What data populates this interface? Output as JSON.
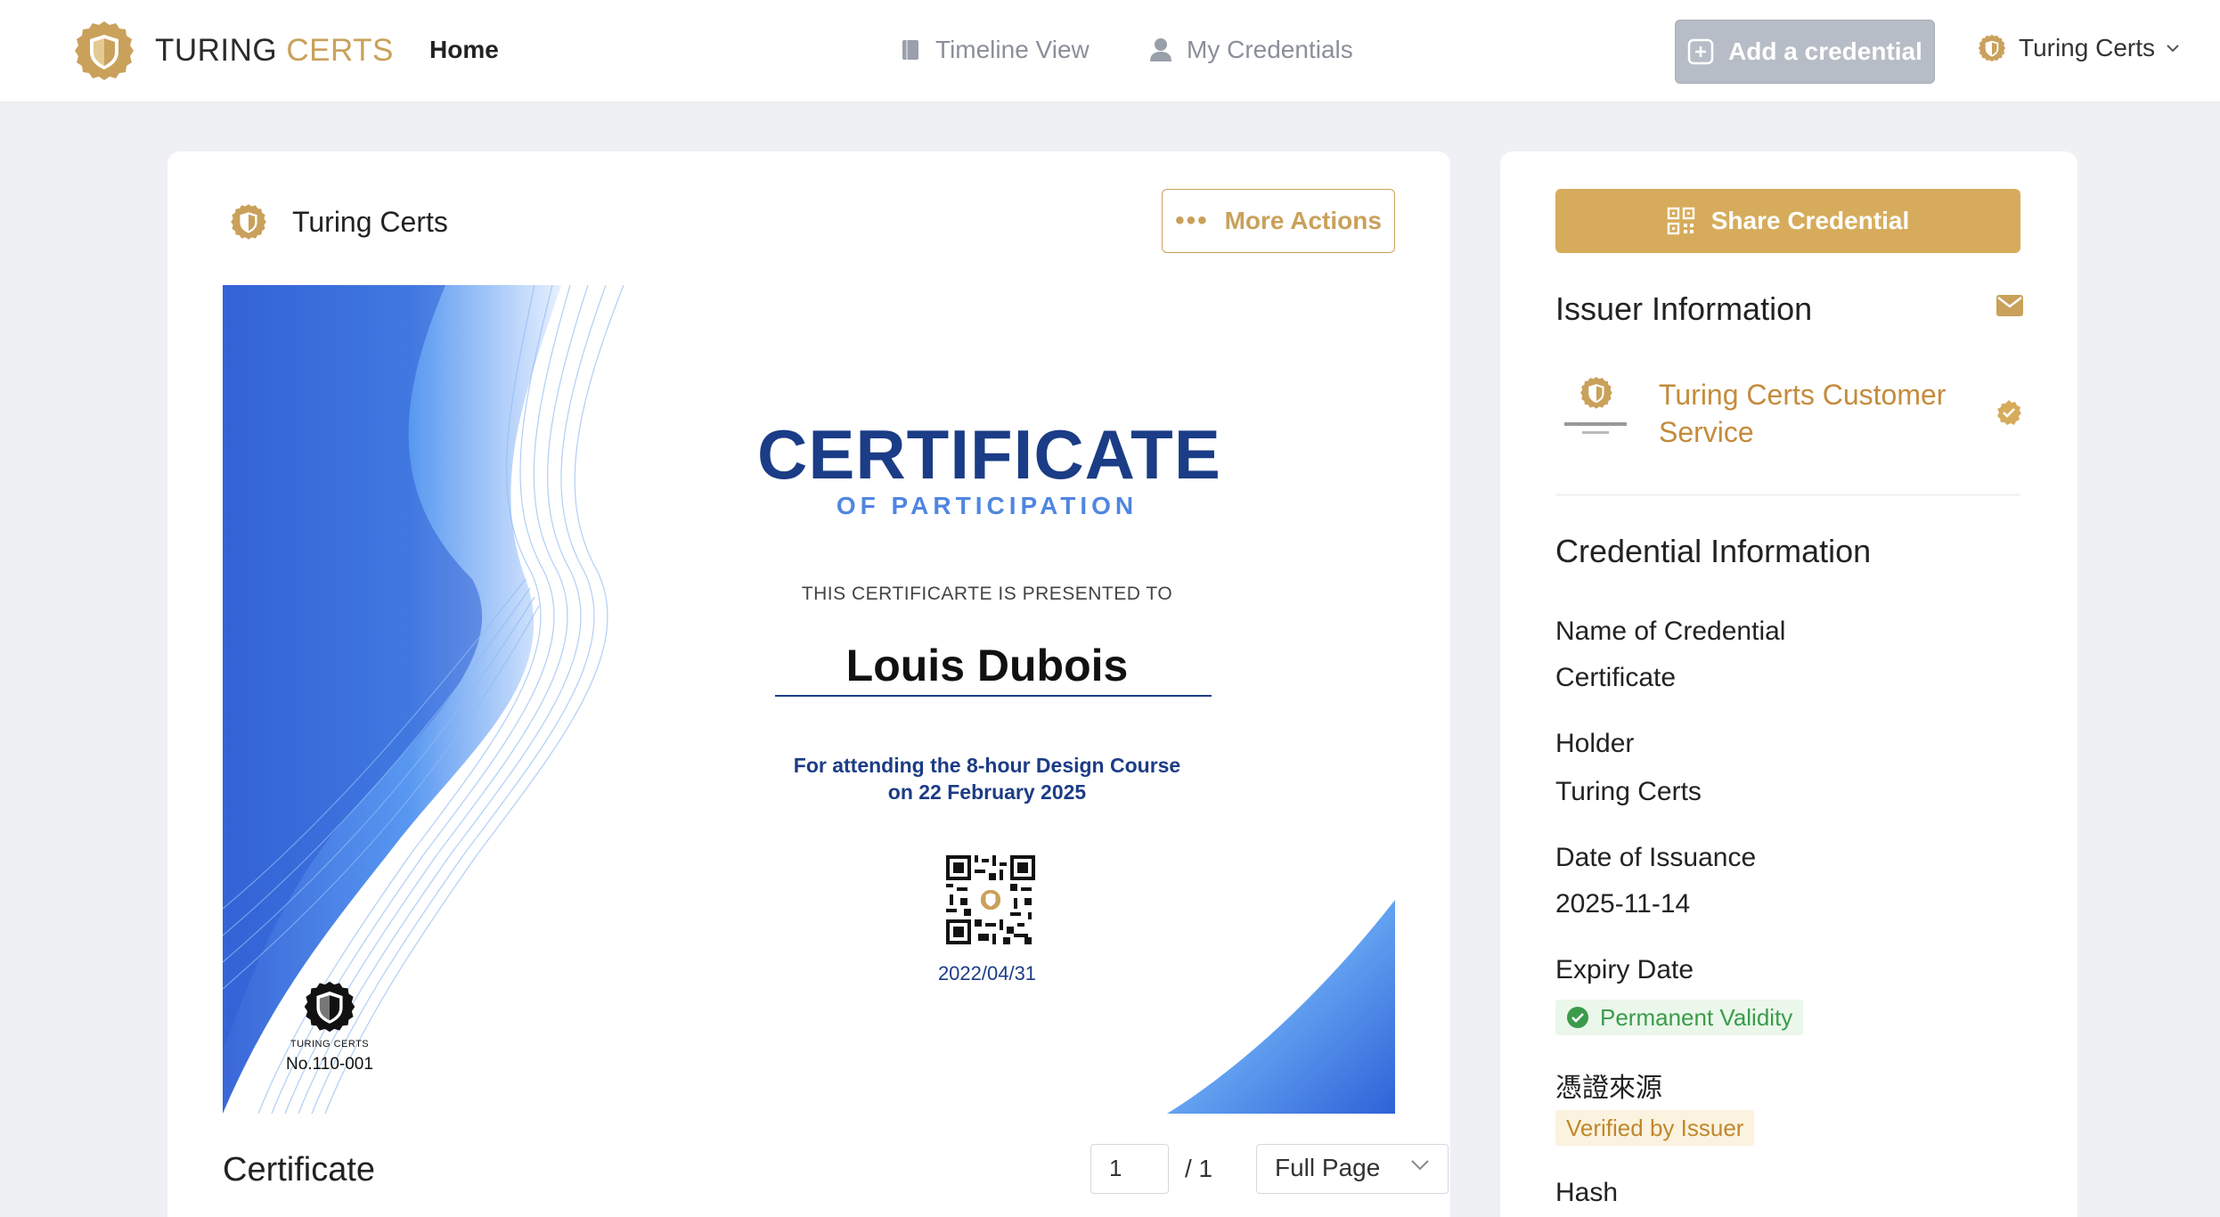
{
  "topnav": {
    "brand_primary": "TURING",
    "brand_accent": "CERTS",
    "home": "Home",
    "timeline": "Timeline View",
    "my_credentials": "My Credentials",
    "add_credential": "Add a credential",
    "user_name": "Turing Certs"
  },
  "main": {
    "issuer_name": "Turing Certs",
    "more_actions": "More Actions",
    "certificate": {
      "title": "CERTIFICATE",
      "subtitle": "OF PARTICIPATION",
      "presented_to": "THIS CERTIFICARTE IS PRESENTED TO",
      "holder": "Louis Dubois",
      "description_line1": "For attending the 8-hour Design Course",
      "description_line2": "on 22 February 2025",
      "date": "2022/04/31",
      "badge_brand": "TURING CERTS",
      "badge_number": "No.110-001"
    },
    "document_label": "Certificate",
    "page_current": "1",
    "page_total": "/ 1",
    "zoom_mode": "Full Page"
  },
  "side": {
    "share": "Share Credential",
    "issuer_info_title": "Issuer Information",
    "issuer_service_name": "Turing Certs Customer Service",
    "credential_info_title": "Credential Information",
    "fields": {
      "name_label": "Name of Credential",
      "name_value": "Certificate",
      "holder_label": "Holder",
      "holder_value": "Turing Certs",
      "issuance_label": "Date of Issuance",
      "issuance_value": "2025-11-14",
      "expiry_label": "Expiry Date",
      "expiry_value": "Permanent Validity",
      "source_label": "憑證來源",
      "source_value": "Verified by Issuer",
      "hash_label": "Hash"
    }
  },
  "colors": {
    "brand_gold": "#c9a15b",
    "share_button": "#d6ac5c",
    "add_button_disabled": "#b7bdc6",
    "certificate_navy": "#1b3c86",
    "certificate_blue": "#4f86e0",
    "valid_green": "#3b9b4b"
  },
  "icons": {
    "brand": "shield-logo-icon",
    "timeline": "book-icon",
    "credentials": "person-icon",
    "add": "plus-square-icon",
    "dropdown": "chevron-down-icon",
    "share": "qr-code-icon",
    "mail": "mail-icon",
    "verified": "verified-badge-icon",
    "valid": "check-circle-icon"
  }
}
